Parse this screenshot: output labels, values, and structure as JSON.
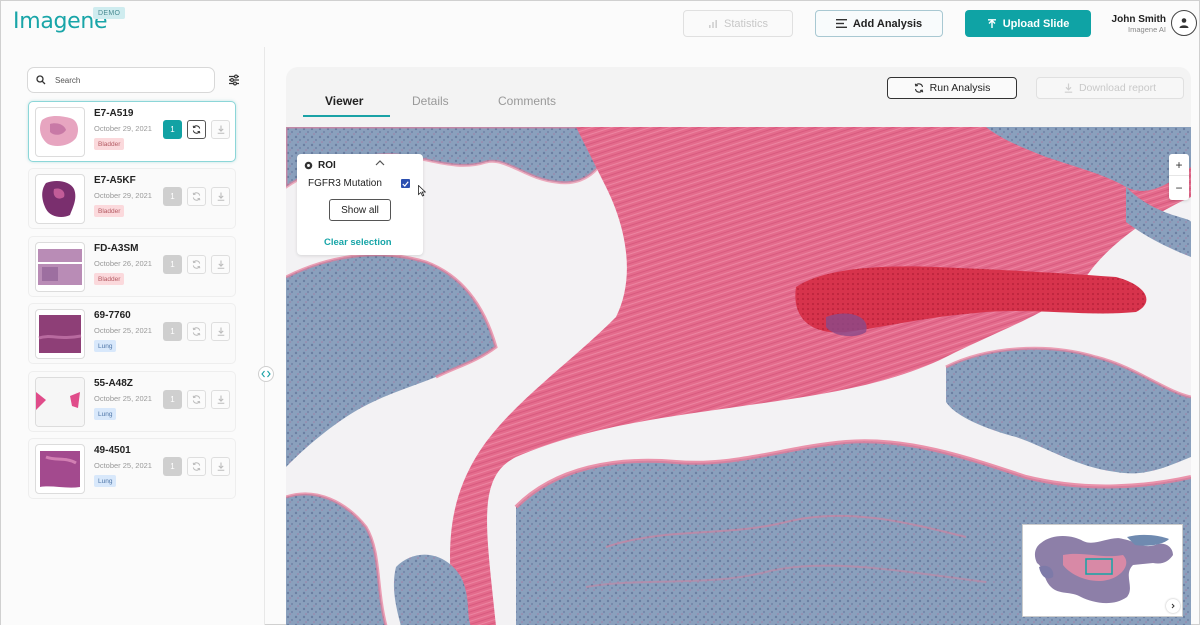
{
  "app": {
    "logo": "Imagene",
    "badge": "DEMO"
  },
  "header": {
    "statistics_label": "Statistics",
    "add_analysis_label": "Add Analysis",
    "upload_label": "Upload Slide",
    "user_name": "John Smith",
    "user_org": "Imagene AI"
  },
  "sidebar": {
    "search_placeholder": "Search",
    "slides": [
      {
        "name": "E7-A519",
        "date": "October 29, 2021",
        "tag": "Bladder",
        "count": "1",
        "selected": true
      },
      {
        "name": "E7-A5KF",
        "date": "October 29, 2021",
        "tag": "Bladder",
        "count": "1",
        "selected": false
      },
      {
        "name": "FD-A3SM",
        "date": "October 26, 2021",
        "tag": "Bladder",
        "count": "1",
        "selected": false
      },
      {
        "name": "69-7760",
        "date": "October 25, 2021",
        "tag": "Lung",
        "count": "1",
        "selected": false
      },
      {
        "name": "55-A48Z",
        "date": "October 25, 2021",
        "tag": "Lung",
        "count": "1",
        "selected": false
      },
      {
        "name": "49-4501",
        "date": "October 25, 2021",
        "tag": "Lung",
        "count": "1",
        "selected": false
      }
    ]
  },
  "main": {
    "tabs": [
      {
        "label": "Viewer",
        "active": true
      },
      {
        "label": "Details",
        "active": false
      },
      {
        "label": "Comments",
        "active": false
      }
    ],
    "run_analysis_label": "Run Analysis",
    "download_report_label": "Download report"
  },
  "roi": {
    "title": "ROI",
    "item_label": "FGFR3 Mutation",
    "item_checked": true,
    "show_all_label": "Show all",
    "clear_label": "Clear selection"
  },
  "zoom": {
    "in": "+",
    "out": "−"
  },
  "colors": {
    "accent": "#12a2a4",
    "bladder_tag": "#fbd9dc",
    "lung_tag": "#d8e8fb",
    "tissue_pink": "#e56a8c",
    "tissue_blue": "#7d95b3"
  }
}
